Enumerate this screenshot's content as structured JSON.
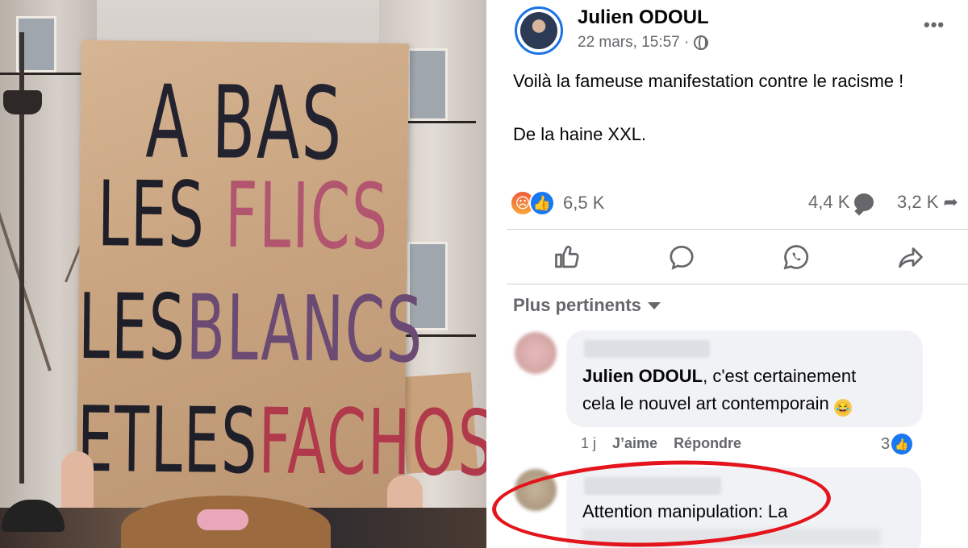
{
  "photo": {
    "sign": {
      "line1": "A BAS",
      "line2_a": "LES ",
      "line2_b": "FLICS",
      "line3_a": "LES",
      "line3_b": "BLANCS",
      "line4_a": "ETLES",
      "line4_b": "FACHOS"
    }
  },
  "post": {
    "author": "Julien ODOUL",
    "timestamp": "22 mars, 15:57 ·",
    "text_line1": "Voilà la fameuse manifestation contre le racisme !",
    "text_line2": "De la haine XXL.",
    "reactions_count": "6,5 K",
    "comments_count": "4,4 K",
    "shares_count": "3,2 K",
    "colors": {
      "accent": "#1877f2",
      "angry": "#f05b3c",
      "annotation": "#e4141c"
    }
  },
  "actions": {
    "like_icon": "thumbs-up-icon",
    "comment_icon": "comment-icon",
    "whatsapp_icon": "whatsapp-icon",
    "share_icon": "share-icon"
  },
  "comments": {
    "filter_label": "Plus pertinents",
    "items": [
      {
        "mention": "Julien ODOUL",
        "text_rest": ", c'est certainement",
        "text_line2": "cela le nouvel art contemporain",
        "age": "1 j",
        "like_label": "J’aime",
        "reply_label": "Répondre",
        "like_count": "3"
      },
      {
        "text": "Attention manipulation: La"
      }
    ]
  }
}
